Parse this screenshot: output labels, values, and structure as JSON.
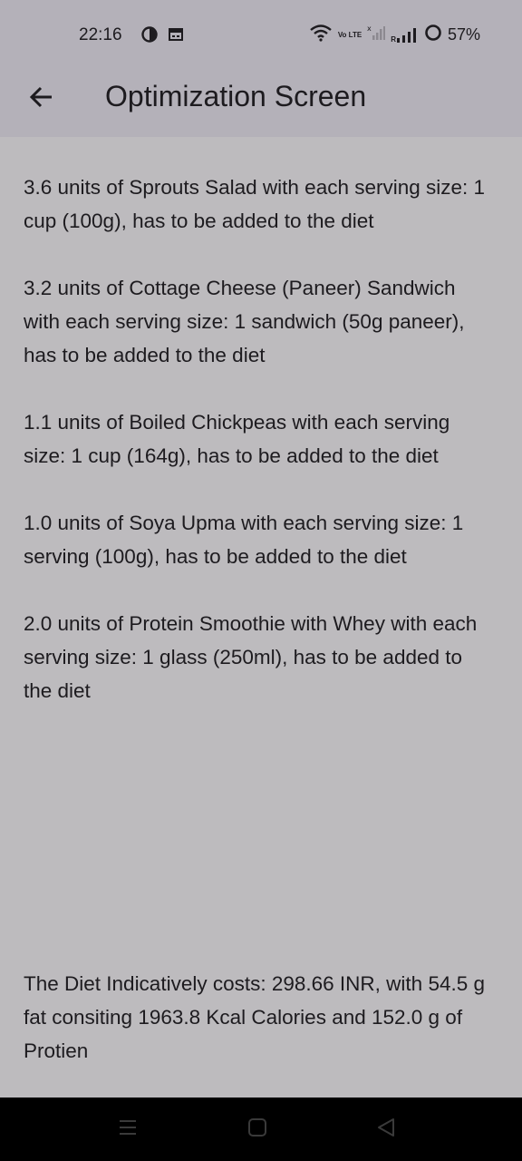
{
  "status_bar": {
    "time": "22:16",
    "battery": "57%",
    "left_icons": [
      "sync-icon",
      "calendar-icon"
    ],
    "right_icons": [
      "wifi-icon",
      "volte-icon",
      "signal-x-icon",
      "signal-icon",
      "battery-ring-icon"
    ],
    "network_label": "Vo LTE",
    "sim_label": "R"
  },
  "app_bar": {
    "back_icon": "arrow-left-icon",
    "title": "Optimization Screen"
  },
  "items": [
    "3.6 units of Sprouts Salad with each serving size: 1 cup (100g), has to be added to the diet",
    "3.2 units of Cottage Cheese (Paneer) Sandwich with each serving size: 1 sandwich (50g paneer), has to be added to the diet",
    "1.1 units of Boiled Chickpeas with each serving size: 1 cup (164g), has to be added to the diet",
    "1.0 units of Soya Upma with each serving size: 1 serving (100g), has to be added to the diet",
    "2.0 units of Protein Smoothie with Whey with each serving size: 1 glass (250ml), has to be added to the diet"
  ],
  "summary": "The Diet Indicatively costs: 298.66 INR, with 54.5 g fat consiting 1963.8 Kcal Calories and 152.0 g of Protien",
  "nav_bar": {
    "icons": [
      "menu-icon",
      "home-square-icon",
      "back-triangle-icon"
    ]
  },
  "colors": {
    "background": "#bdbbbe",
    "app_bar": "#b4b1b9",
    "text": "#1d1b1f",
    "nav_bar": "#000000"
  }
}
